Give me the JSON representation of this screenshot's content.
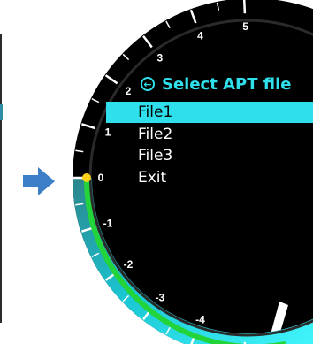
{
  "colors": {
    "accent": "#2fe0ec",
    "gauge_bar": "#22d43a",
    "indicator_dot": "#ffd21a",
    "arrow": "#3d7fc6",
    "dial_background": "#000000"
  },
  "gauge": {
    "tick_labels": [
      "-4",
      "-3",
      "-2",
      "-1",
      "0",
      "1",
      "2",
      "3",
      "4",
      "5"
    ],
    "current_value": "0",
    "pointer_icon": "arrow-right-icon"
  },
  "menu": {
    "title": "Select APT file",
    "back_icon": "back-circle-arrow-icon",
    "items": [
      {
        "label": "File1",
        "selected": true
      },
      {
        "label": "File2",
        "selected": false
      },
      {
        "label": "File3",
        "selected": false
      },
      {
        "label": "Exit",
        "selected": false
      }
    ]
  }
}
